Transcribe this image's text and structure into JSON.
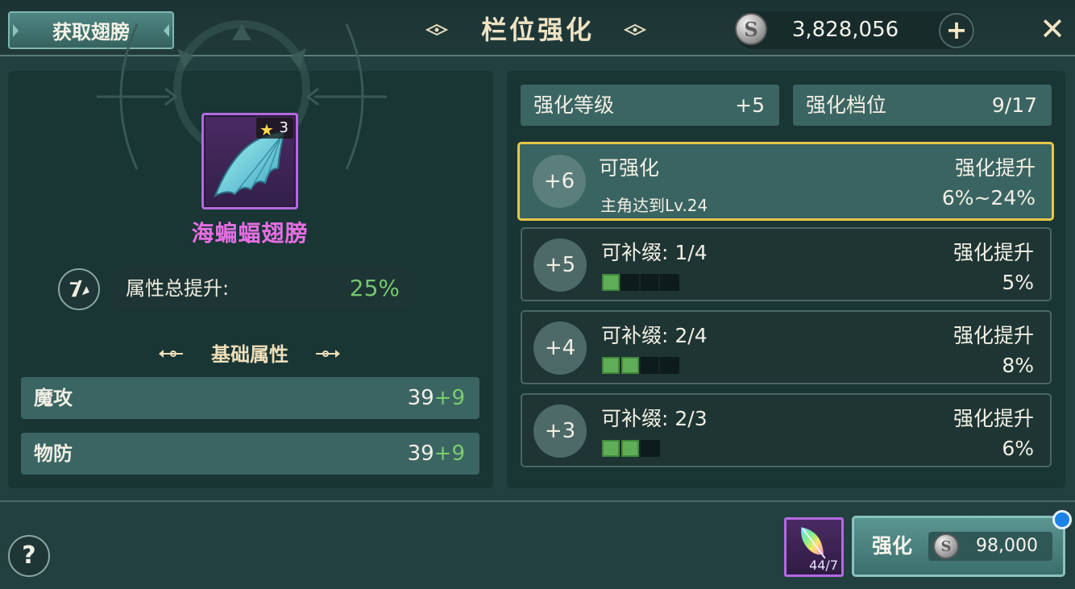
{
  "header": {
    "get_wings_label": "获取翅膀",
    "title": "栏位强化",
    "currency_value": "3,828,056",
    "plus_label": "+",
    "close_label": "✕",
    "coin_symbol": "S"
  },
  "item": {
    "name": "海蝙蝠翅膀",
    "stars": "3",
    "star_icon": "star-icon",
    "frame_color": "#b36ae0"
  },
  "attributes": {
    "total_label": "属性总提升:",
    "total_value": "25%",
    "section_title": "基础属性",
    "stats": [
      {
        "name": "魔攻",
        "base": "39",
        "bonus": "+9"
      },
      {
        "name": "物防",
        "base": "39",
        "bonus": "+9"
      }
    ]
  },
  "enhance_info": {
    "level_label": "强化等级",
    "level_value": "+5",
    "tier_label": "强化档位",
    "tier_value": "9/17"
  },
  "levels": [
    {
      "level": "+6",
      "title": "可强化",
      "sub": "主角达到Lv.24",
      "boost_label": "强化提升",
      "boost_value": "6%~24%",
      "filled": 0,
      "total": 0,
      "active": true
    },
    {
      "level": "+5",
      "title": "可补缀: 1/4",
      "boost_label": "强化提升",
      "boost_value": "5%",
      "filled": 1,
      "total": 4
    },
    {
      "level": "+4",
      "title": "可补缀: 2/4",
      "boost_label": "强化提升",
      "boost_value": "8%",
      "filled": 2,
      "total": 4
    },
    {
      "level": "+3",
      "title": "可补缀: 2/3",
      "boost_label": "强化提升",
      "boost_value": "6%",
      "filled": 2,
      "total": 3
    }
  ],
  "footer": {
    "help_label": "?",
    "material_count": "44/7",
    "enhance_label": "强化",
    "enhance_cost": "98,000"
  },
  "colors": {
    "accent_gold": "#e6c74a",
    "bonus_green": "#7acd6f",
    "rare_purple": "#b36ae0",
    "notify_blue": "#1c82e6"
  }
}
